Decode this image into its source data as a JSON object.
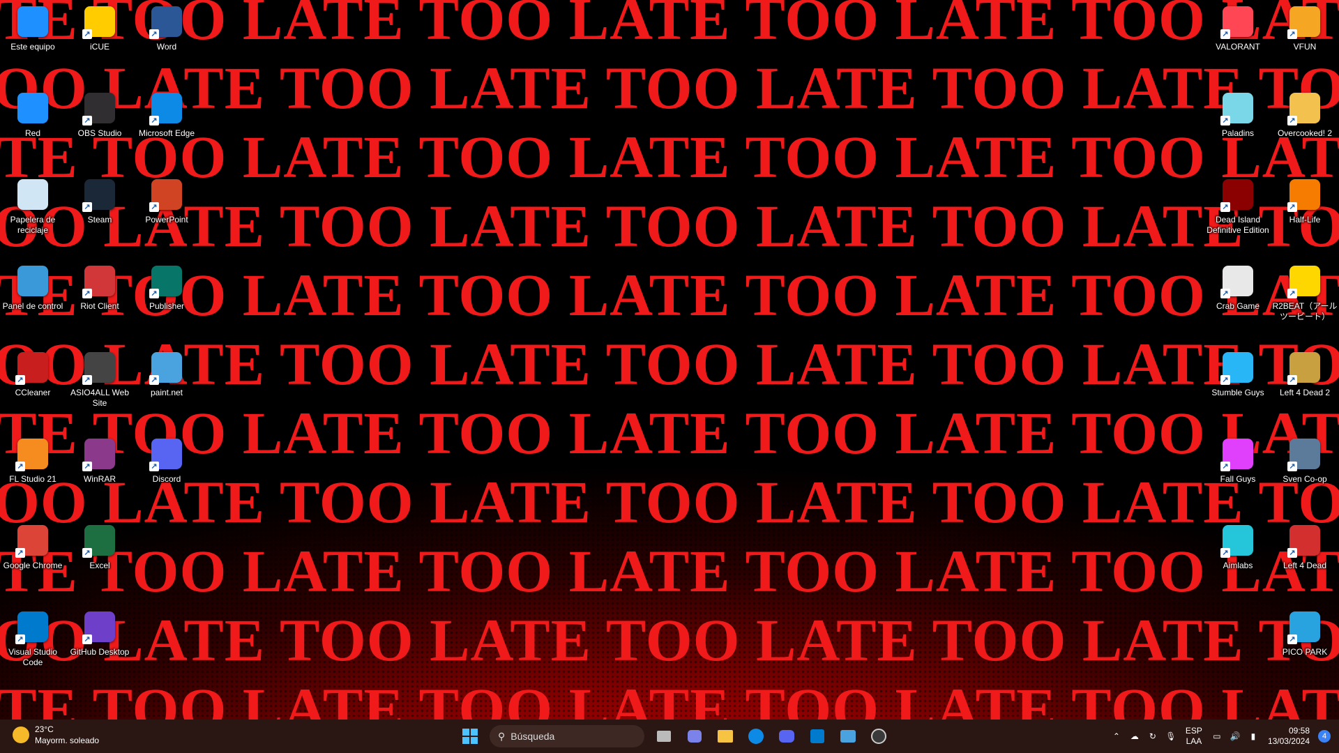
{
  "wallpaper": {
    "text": "LATE TOO LATE TOO LATE TOO LATE TOO LATE TOO LATE TOO LATE TOO LATE TOO LATE TOO",
    "text_alt": "OO LATE TOO LATE TOO LATE TOO LATE TOO LATE TOO LATE TOO LATE TOO LATE TOO LATE",
    "colors": {
      "text": "#f01a1a",
      "background": "#000000",
      "glow": "#c00000"
    }
  },
  "desktop_icons": [
    {
      "label": "Este equipo",
      "icon": "computer-icon",
      "color": "#1e90ff"
    },
    {
      "label": "iCUE",
      "icon": "icue-icon",
      "color": "#ffcc00"
    },
    {
      "label": "Word",
      "icon": "word-icon",
      "color": "#2b5797"
    },
    {
      "label": "Red",
      "icon": "network-icon",
      "color": "#1e90ff"
    },
    {
      "label": "OBS Studio",
      "icon": "obs-icon",
      "color": "#302e31"
    },
    {
      "label": "Microsoft Edge",
      "icon": "edge-icon",
      "color": "#0c8ae6"
    },
    {
      "label": "Papelera de reciclaje",
      "icon": "recycle-bin-icon",
      "color": "#d0e6f5"
    },
    {
      "label": "Steam",
      "icon": "steam-icon",
      "color": "#1b2838"
    },
    {
      "label": "PowerPoint",
      "icon": "powerpoint-icon",
      "color": "#d04423"
    },
    {
      "label": "Panel de control",
      "icon": "control-panel-icon",
      "color": "#3a9ad9"
    },
    {
      "label": "Riot Client",
      "icon": "riot-client-icon",
      "color": "#d13639"
    },
    {
      "label": "Publisher",
      "icon": "publisher-icon",
      "color": "#077568"
    },
    {
      "label": "CCleaner",
      "icon": "ccleaner-icon",
      "color": "#c81e1e"
    },
    {
      "label": "ASIO4ALL Web Site",
      "icon": "asio-icon",
      "color": "#444444"
    },
    {
      "label": "paint.net",
      "icon": "paintnet-icon",
      "color": "#4aa3df"
    },
    {
      "label": "FL Studio 21",
      "icon": "fl-studio-icon",
      "color": "#f68b1f"
    },
    {
      "label": "WinRAR",
      "icon": "winrar-icon",
      "color": "#8b3a8b"
    },
    {
      "label": "Discord",
      "icon": "discord-icon",
      "color": "#5865f2"
    },
    {
      "label": "Google Chrome",
      "icon": "chrome-icon",
      "color": "#db4437"
    },
    {
      "label": "Excel",
      "icon": "excel-icon",
      "color": "#1d6f42"
    },
    {
      "label": "Visual Studio Code",
      "icon": "vscode-icon",
      "color": "#007acc"
    },
    {
      "label": "GitHub Desktop",
      "icon": "github-desktop-icon",
      "color": "#6e40c9"
    },
    {
      "label": "VALORANT",
      "icon": "valorant-icon",
      "color": "#ff4655"
    },
    {
      "label": "VFUN",
      "icon": "vfun-icon",
      "color": "#f5a623"
    },
    {
      "label": "Paladins",
      "icon": "paladins-icon",
      "color": "#7ad7e8"
    },
    {
      "label": "Overcooked! 2",
      "icon": "overcooked-icon",
      "color": "#f2c14e"
    },
    {
      "label": "Dead Island Definitive Edition",
      "icon": "dead-island-icon",
      "color": "#8b0000"
    },
    {
      "label": "Half-Life",
      "icon": "half-life-icon",
      "color": "#f57c00"
    },
    {
      "label": "Crab Game",
      "icon": "crab-game-icon",
      "color": "#e8e8e8"
    },
    {
      "label": "R2BEAT（アールツービート）",
      "icon": "r2beat-icon",
      "color": "#ffd700"
    },
    {
      "label": "Stumble Guys",
      "icon": "stumble-guys-icon",
      "color": "#29b6f6"
    },
    {
      "label": "Left 4 Dead 2",
      "icon": "left4dead2-icon",
      "color": "#c8a040"
    },
    {
      "label": "Fall Guys",
      "icon": "fall-guys-icon",
      "color": "#e040fb"
    },
    {
      "label": "Sven Co-op",
      "icon": "sven-coop-icon",
      "color": "#5c7a99"
    },
    {
      "label": "Aimlabs",
      "icon": "aimlabs-icon",
      "color": "#26c6da"
    },
    {
      "label": "Left 4 Dead",
      "icon": "left4dead-icon",
      "color": "#d32f2f"
    },
    {
      "label": "PICO PARK",
      "icon": "pico-park-icon",
      "color": "#29a3e0"
    }
  ],
  "taskbar": {
    "weather": {
      "temp": "23°C",
      "condition": "Mayorm. soleado"
    },
    "search_placeholder": "Búsqueda",
    "pinned": [
      "windows-start-icon",
      "task-view-icon",
      "teams-chat-icon",
      "file-explorer-icon",
      "edge-icon",
      "discord-icon",
      "vscode-icon",
      "app-icon",
      "obs-icon"
    ],
    "tray": {
      "lang_top": "ESP",
      "lang_bottom": "LAA",
      "time": "09:58",
      "date": "13/03/2024",
      "notifications": "4"
    }
  }
}
